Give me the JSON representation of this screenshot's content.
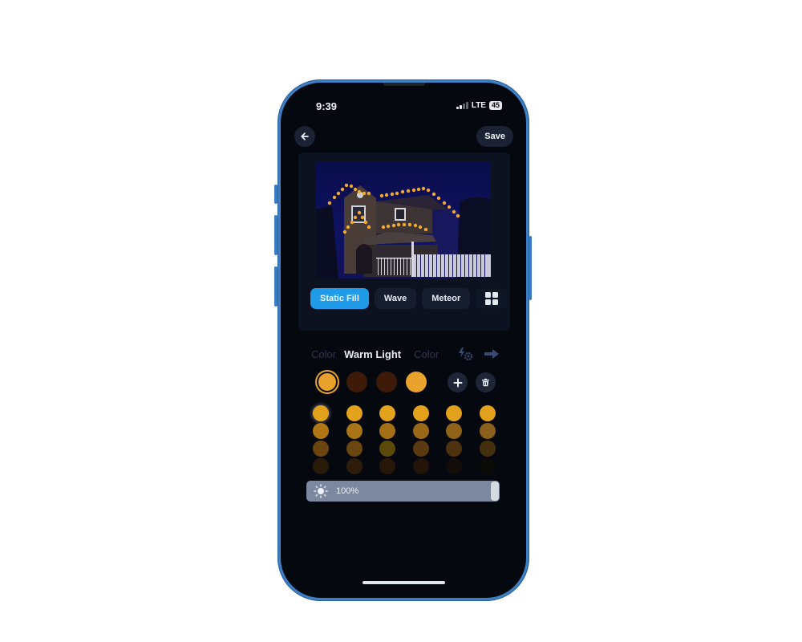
{
  "status_bar": {
    "time": "9:39",
    "network": "LTE",
    "battery": "45"
  },
  "nav": {
    "back_icon": "arrow-left-icon",
    "save_label": "Save"
  },
  "preview": {
    "image_description": "Two-story house at night with warm yellow roofline lights and white picket fence"
  },
  "effect_tabs": [
    {
      "label": "Static Fill",
      "active": true
    },
    {
      "label": "Wave",
      "active": false
    },
    {
      "label": "Meteor",
      "active": false
    }
  ],
  "more_effects_icon": "grid-icon",
  "color_mode": {
    "left": "Color",
    "center": "Warm Light",
    "right": "Color",
    "effects_icon": "lightning-gear-icon",
    "next_icon": "arrow-right-icon"
  },
  "selected_colors": [
    "#e9a32d",
    "#3e1a08",
    "#3e1a08",
    "#e9a32d"
  ],
  "selected_index": 0,
  "palette": [
    [
      "#e2a21b",
      "#e2a21b",
      "#e2a21b",
      "#e2a21b",
      "#e2a21b",
      "#e2a21b"
    ],
    [
      "#b07614",
      "#a87416",
      "#a37015",
      "#9a6818",
      "#8e6218",
      "#8a5f1c"
    ],
    [
      "#6b4510",
      "#6a4610",
      "#5c4a0a",
      "#5b3a12",
      "#4e3210",
      "#44300f"
    ],
    [
      "#2a1a08",
      "#2c1c09",
      "#271708",
      "#221508",
      "#120d08",
      "#0c0a08"
    ]
  ],
  "brightness": {
    "label": "100%",
    "value_percent": 100
  }
}
